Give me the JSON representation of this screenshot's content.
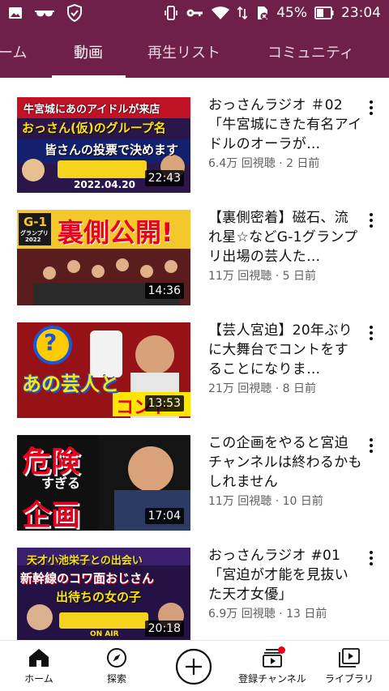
{
  "status_bar": {
    "battery_percent": "45%",
    "time": "23:04",
    "icons": [
      "image-icon",
      "glasses-icon",
      "shield-check-icon",
      "vibrate-icon",
      "key-icon",
      "wifi-icon",
      "data-icon",
      "no-sim-icon",
      "battery-icon"
    ]
  },
  "tabs": [
    {
      "label": "ーム",
      "active": false
    },
    {
      "label": "動画",
      "active": true
    },
    {
      "label": "再生リスト",
      "active": false
    },
    {
      "label": "コミュニティ",
      "active": false
    }
  ],
  "videos": [
    {
      "title": "おっさんラジオ ＃02「牛宮城にきた有名アイドルのオーラが…",
      "meta": "6.4万 回視聴 · 2 日前",
      "duration": "22:43",
      "thumb_text": {
        "line1": "牛宮城にあのアイドルが来店",
        "line2": "おっさん(仮)のグループ名",
        "line3": "皆さんの投票で決めます",
        "date": "2022.04.20"
      }
    },
    {
      "title": "【裏側密着】磁石、流れ星☆などG-1グランプリ出場の芸人た…",
      "meta": "11万 回視聴 · 5 日前",
      "duration": "14:36",
      "thumb_text": {
        "line1": "裏側公開!",
        "badge": "G-1",
        "badge_sub": "グランプリ",
        "year": "2022"
      }
    },
    {
      "title": "【芸人宮迫】20年ぶりに大舞台でコントをすることになりま…",
      "meta": "21万 回視聴 · 8 日前",
      "duration": "13:53",
      "thumb_text": {
        "line1": "あの芸人と",
        "line2": "コント",
        "mark": "?"
      }
    },
    {
      "title": "この企画をやると宮迫チャンネルは終わるかもしれません",
      "meta": "11万 回視聴 · 10 日前",
      "duration": "17:04",
      "thumb_text": {
        "line1": "危険",
        "line2": "すぎる",
        "line3": "企画"
      }
    },
    {
      "title": "おっさんラジオ #01「宮迫が才能を見抜いた天才女優」",
      "meta": "6.9万 回視聴 · 13 日前",
      "duration": "20:18",
      "thumb_text": {
        "line1": "天才小池栄子との出会い",
        "line2": "新幹線のコワ面おじさん",
        "line3": "出待ちの女の子",
        "onair": "ON AIR"
      }
    }
  ],
  "bottom_nav": [
    {
      "label": "ホーム",
      "icon": "home-icon",
      "active": true
    },
    {
      "label": "探索",
      "icon": "compass-icon",
      "active": false
    },
    {
      "label": "",
      "icon": "create-plus-icon",
      "active": false
    },
    {
      "label": "登録チャンネル",
      "icon": "subscriptions-icon",
      "active": false,
      "badge": true
    },
    {
      "label": "ライブラリ",
      "icon": "library-icon",
      "active": false
    }
  ],
  "colors": {
    "brand_bar": "#6e1f4a",
    "badge_red": "#e8001c"
  }
}
